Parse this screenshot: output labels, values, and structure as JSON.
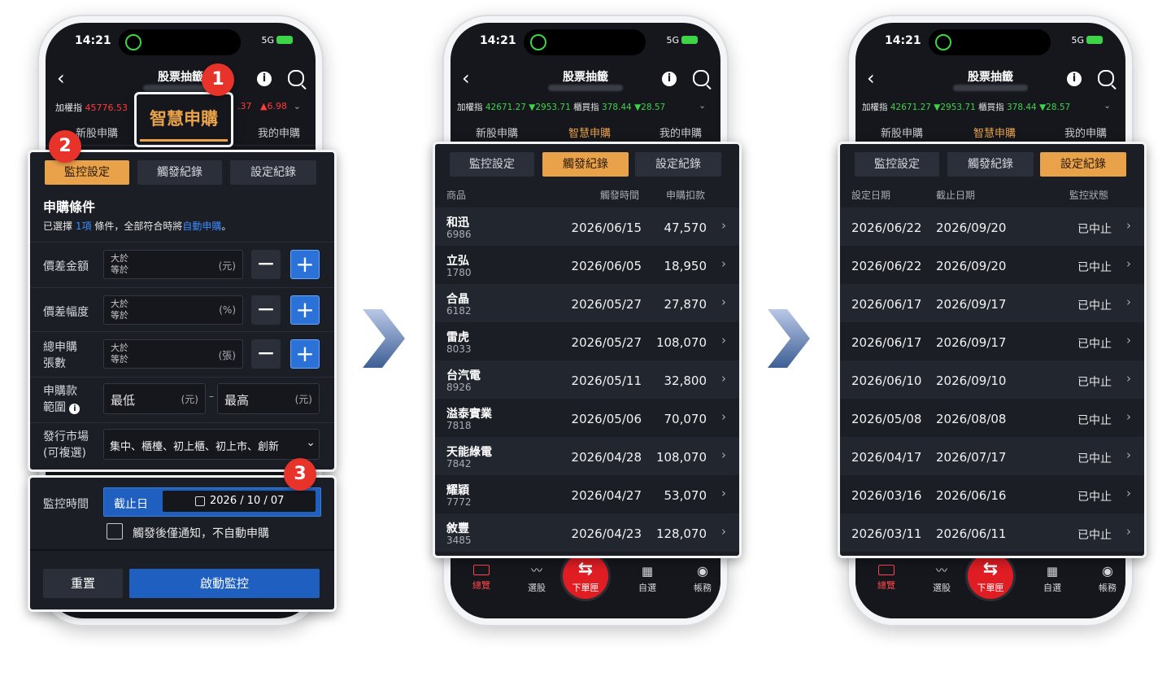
{
  "status": {
    "time": "14:21",
    "signal": "5G"
  },
  "header": {
    "title": "股票抽籤"
  },
  "ticker_left": {
    "label1": "加權指",
    "val1": "45776.53",
    "val2": ".37",
    "chg2": "▲6.98"
  },
  "ticker": {
    "label1": "加權指",
    "val1": "42671.27",
    "chg1": "▼2953.71",
    "label2": "櫃買指",
    "val2": "378.44",
    "chg2": "▼28.57"
  },
  "tabs": [
    "新股申購",
    "智慧申購",
    "我的申購"
  ],
  "callout": {
    "text": "智慧申購"
  },
  "badges": [
    "1",
    "2",
    "3"
  ],
  "segments": [
    "監控設定",
    "觸發紀錄",
    "設定紀錄"
  ],
  "settings": {
    "heading": "申購條件",
    "hint_pre": "已選擇",
    "hint_count": "1項",
    "hint_mid": "條件，全部符合時將",
    "hint_auto": "自動申購",
    "hint_end": "。",
    "rows": [
      {
        "label": "價差金額",
        "opt1": "大於",
        "opt2": "等於",
        "unit": "(元)"
      },
      {
        "label": "價差幅度",
        "opt1": "大於",
        "opt2": "等於",
        "unit": "(%)"
      },
      {
        "label": "總申購",
        "label2": "張數",
        "opt1": "大於",
        "opt2": "等於",
        "unit": "(張)"
      }
    ],
    "range_label": "申購款",
    "range_label2": "範圍",
    "range_min": "最低",
    "range_max": "最高",
    "range_unit": "(元)",
    "range_sep": "–",
    "market_label": "發行市場",
    "market_label2": "(可複選)",
    "market_value": "集中、櫃檯、初上櫃、初上市、創新"
  },
  "monitor": {
    "label": "監控時間",
    "deadline_label": "截止日",
    "date": "2026 / 10 / 07",
    "checkbox": "觸發後僅通知，不自動申購",
    "reset": "重置",
    "start": "啟動監控"
  },
  "trigger": {
    "headers": [
      "商品",
      "觸發時間",
      "申購扣款"
    ],
    "rows": [
      {
        "name": "和迅",
        "code": "6986",
        "date": "2026/06/15",
        "amount": "47,570"
      },
      {
        "name": "立弘",
        "code": "1780",
        "date": "2026/06/05",
        "amount": "18,950"
      },
      {
        "name": "合晶",
        "code": "6182",
        "date": "2026/05/27",
        "amount": "27,870"
      },
      {
        "name": "雷虎",
        "code": "8033",
        "date": "2026/05/27",
        "amount": "108,070"
      },
      {
        "name": "台汽電",
        "code": "8926",
        "date": "2026/05/11",
        "amount": "32,800"
      },
      {
        "name": "溢泰實業",
        "code": "7818",
        "date": "2026/05/06",
        "amount": "70,070"
      },
      {
        "name": "天能綠電",
        "code": "7842",
        "date": "2026/04/28",
        "amount": "108,070"
      },
      {
        "name": "耀穎",
        "code": "7772",
        "date": "2026/04/27",
        "amount": "53,070"
      },
      {
        "name": "敘豐",
        "code": "3485",
        "date": "2026/04/23",
        "amount": "128,070"
      }
    ]
  },
  "records": {
    "headers": [
      "設定日期",
      "截止日期",
      "監控狀態"
    ],
    "rows": [
      {
        "set": "2026/06/22",
        "end": "2026/09/20",
        "status": "已中止"
      },
      {
        "set": "2026/06/22",
        "end": "2026/09/20",
        "status": "已中止"
      },
      {
        "set": "2026/06/17",
        "end": "2026/09/17",
        "status": "已中止"
      },
      {
        "set": "2026/06/17",
        "end": "2026/09/17",
        "status": "已中止"
      },
      {
        "set": "2026/06/10",
        "end": "2026/09/10",
        "status": "已中止"
      },
      {
        "set": "2026/05/08",
        "end": "2026/08/08",
        "status": "已中止"
      },
      {
        "set": "2026/04/17",
        "end": "2026/07/17",
        "status": "已中止"
      },
      {
        "set": "2026/03/16",
        "end": "2026/06/16",
        "status": "已中止"
      },
      {
        "set": "2026/03/11",
        "end": "2026/06/11",
        "status": "已中止"
      }
    ]
  },
  "bottom_nav": [
    "總覽",
    "選股",
    "下單匣",
    "自選",
    "帳務"
  ],
  "colors": {
    "accent": "#e9a24a",
    "up": "#ff3b3b",
    "down": "#3fd34a",
    "primary": "#2a72d8",
    "badge": "#e8332a"
  }
}
